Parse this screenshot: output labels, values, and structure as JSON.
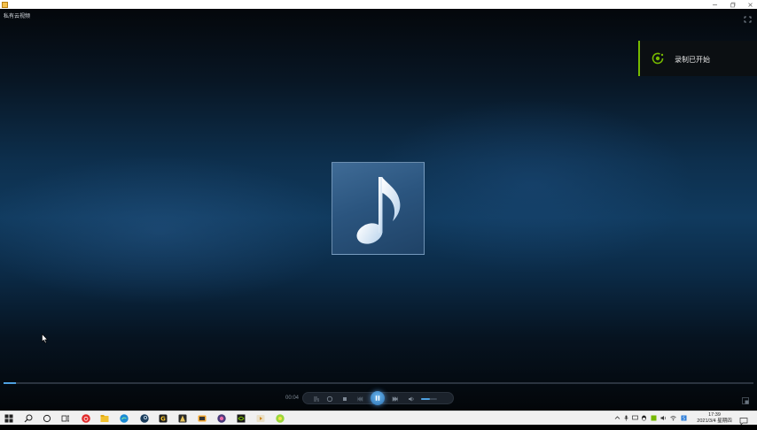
{
  "window": {
    "title": "",
    "controls": [
      "minimize",
      "restore",
      "close"
    ]
  },
  "player": {
    "title": "私有云视频",
    "current_time": "00:04",
    "progress_fraction": 0.016,
    "volume_fraction": 0.55,
    "state": "playing",
    "album_art_icon": "music-note-icon"
  },
  "notification": {
    "text": "录制已开始",
    "accent_color": "#76b900",
    "icon": "record-icon"
  },
  "controls": {
    "buttons": [
      "playlist-icon",
      "loop-icon",
      "stop-icon",
      "previous-icon",
      "pause-icon",
      "next-icon",
      "volume-icon"
    ]
  },
  "taskbar": {
    "pinned": [
      "windows-start-icon",
      "search-icon",
      "cortana-icon",
      "task-view-icon",
      "netease-music-icon",
      "file-explorer-icon",
      "edge-icon",
      "steam-icon",
      "game-icon",
      "launcher-icon",
      "media-icon",
      "game2-icon",
      "nvidia-icon",
      "player-icon",
      "app-icon"
    ],
    "clock_time": "17:39",
    "clock_date": "2021/3/4 星期四",
    "accent_color": "#0078d7"
  }
}
